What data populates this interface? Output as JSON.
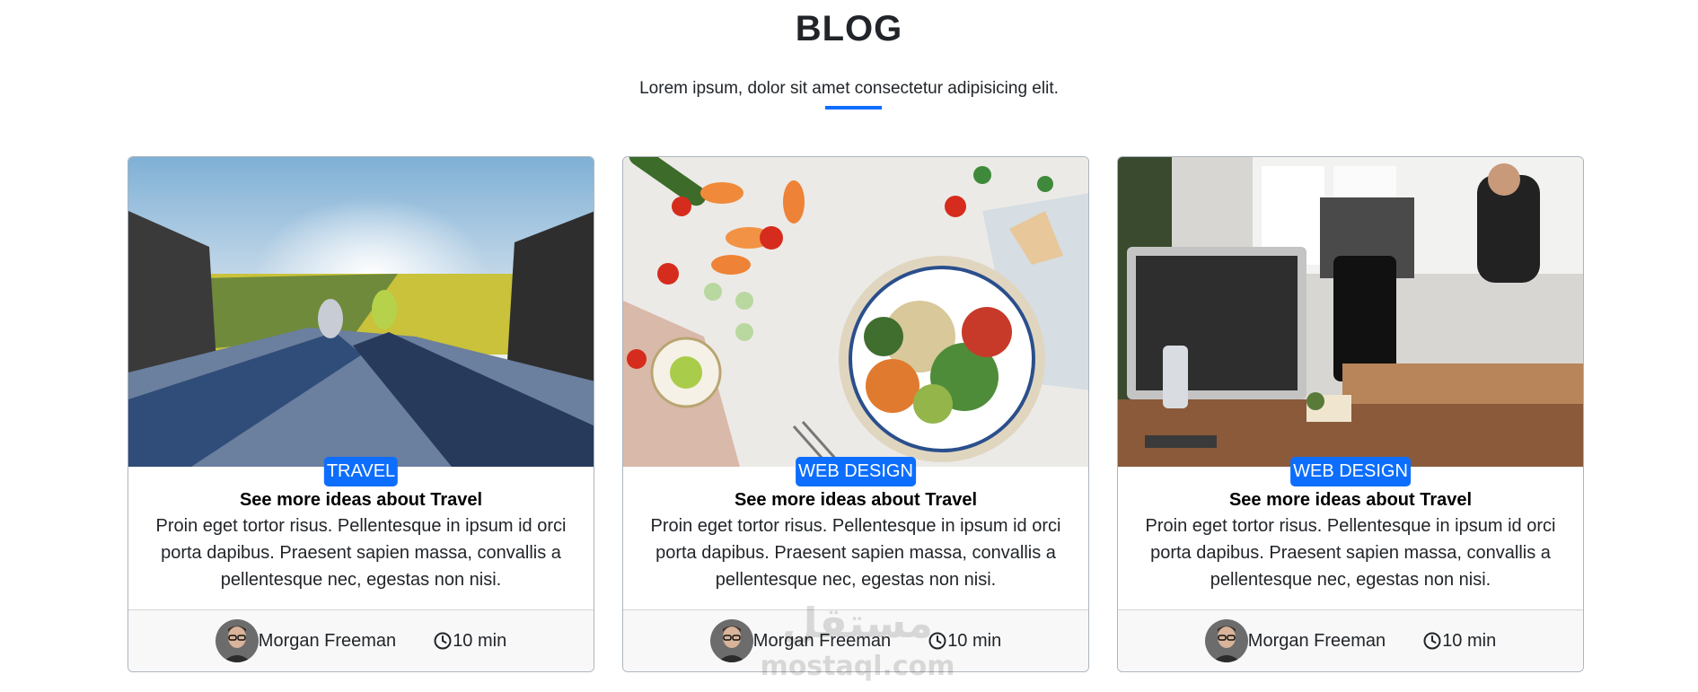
{
  "section": {
    "title": "BLOG",
    "subtitle": "Lorem ipsum, dolor sit amet consectetur adipisicing elit."
  },
  "colors": {
    "accent": "#0d6efd",
    "footer_bg": "#f8f8f8",
    "border": "#adb5bd"
  },
  "cards": [
    {
      "category": "TRAVEL",
      "title": "See more ideas about Travel",
      "text": "Proin eget tortor risus. Pellentesque in ipsum id orci porta dapibus. Praesent sapien massa, convallis a pellentesque nec, egestas non nisi.",
      "author": "Morgan Freeman",
      "time": "10 min",
      "image": "travel-car-trunk-photo"
    },
    {
      "category": "WEB DESIGN",
      "title": "See more ideas about Travel",
      "text": "Proin eget tortor risus. Pellentesque in ipsum id orci porta dapibus. Praesent sapien massa, convallis a pellentesque nec, egestas non nisi.",
      "author": "Morgan Freeman",
      "time": "10 min",
      "image": "food-bowl-photo"
    },
    {
      "category": "WEB DESIGN",
      "title": "See more ideas about Travel",
      "text": "Proin eget tortor risus. Pellentesque in ipsum id orci porta dapibus. Praesent sapien massa, convallis a pellentesque nec, egestas non nisi.",
      "author": "Morgan Freeman",
      "time": "10 min",
      "image": "office-workspace-photo"
    }
  ],
  "watermark": {
    "arabic": "مستقل",
    "latin": "mostaql.com"
  }
}
